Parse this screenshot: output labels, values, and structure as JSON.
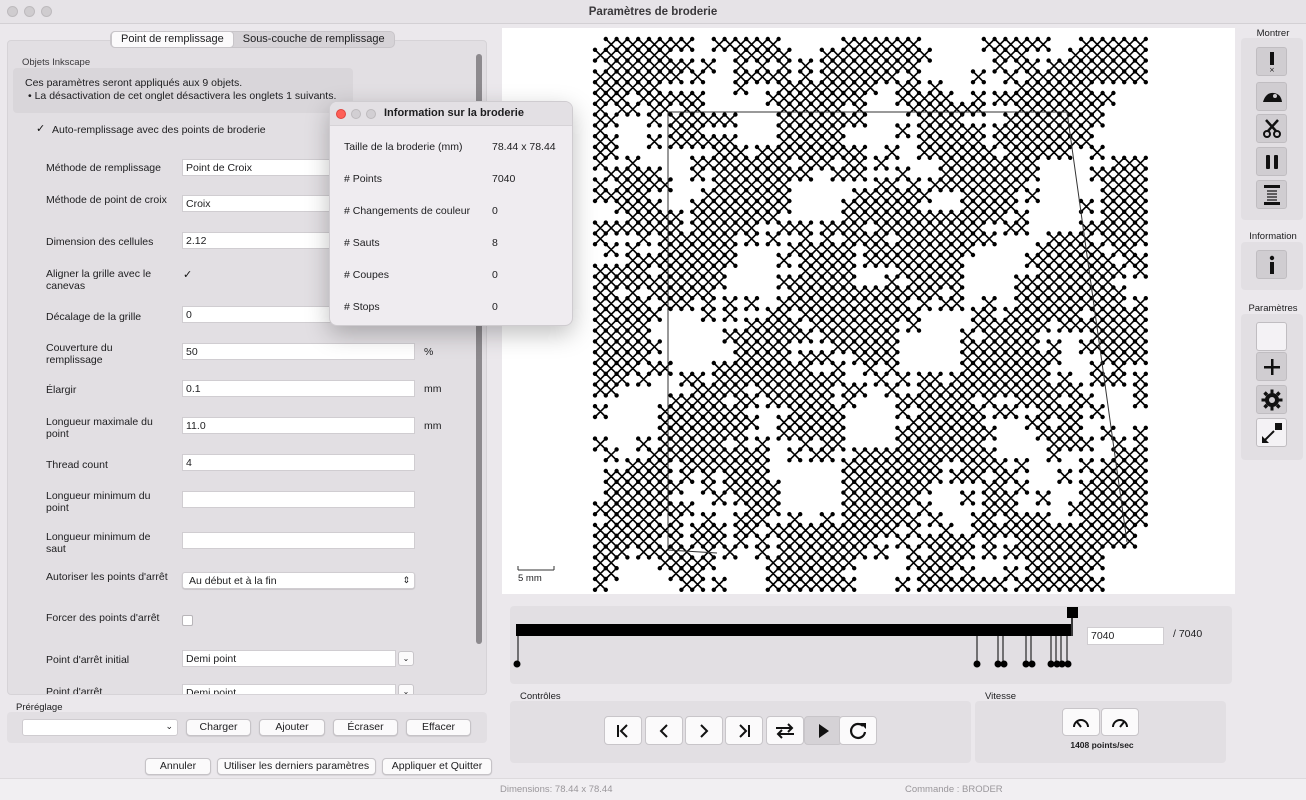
{
  "window": {
    "title": "Paramètres de broderie"
  },
  "tabs": [
    "Point de remplissage",
    "Sous-couche de remplissage"
  ],
  "section_label": "Objets Inkscape",
  "note": {
    "line1": "Ces paramètres seront appliqués aux 9 objets.",
    "line2": "• La désactivation de cet onglet désactivera les onglets 1 suivants."
  },
  "autofill_label": "Auto-remplissage avec des points de broderie",
  "fields": {
    "fill_method": {
      "label": "Méthode de remplissage",
      "value": "Point de Croix"
    },
    "stitch_method": {
      "label": "Méthode de point de croix",
      "value": "Croix"
    },
    "cell_size": {
      "label": "Dimension des cellules",
      "value": "2.12"
    },
    "align_grid": {
      "label": "Aligner la grille avec le canevas"
    },
    "grid_offset": {
      "label": "Décalage de la grille",
      "value": "0"
    },
    "coverage": {
      "label": "Couverture du remplissage",
      "value": "50",
      "unit": "%"
    },
    "expand": {
      "label": "Élargir",
      "value": "0.1",
      "unit": "mm"
    },
    "max_length": {
      "label": "Longueur maximale du point",
      "value": "11.0",
      "unit": "mm"
    },
    "thread_count": {
      "label": "Thread count",
      "value": "4"
    },
    "min_stitch": {
      "label": "Longueur minimum du point",
      "value": ""
    },
    "min_jump": {
      "label": "Longueur minimum de saut",
      "value": ""
    },
    "allow_lock": {
      "label": "Autoriser les points d'arrêt",
      "value": "Au début et à la fin"
    },
    "force_lock": {
      "label": "Forcer des points d'arrêt"
    },
    "initial_lock": {
      "label": "Point d'arrêt initial",
      "value": "Demi point"
    },
    "final_lock": {
      "label": "Point d'arrêt",
      "value": "Demi point"
    }
  },
  "preset": {
    "label": "Préréglage",
    "load": "Charger",
    "add": "Ajouter",
    "overwrite": "Écraser",
    "delete": "Effacer"
  },
  "footer": {
    "cancel": "Annuler",
    "use_last": "Utiliser les derniers paramètres",
    "apply_quit": "Appliquer et Quitter"
  },
  "preview": {
    "scale_label": "5 mm"
  },
  "timeline": {
    "current": "7040",
    "total": "/ 7040",
    "progress": 1.0
  },
  "controls": {
    "label": "Contrôles"
  },
  "speed": {
    "label": "Vitesse",
    "value": "1408 points/sec"
  },
  "sidebar": {
    "show_label": "Montrer",
    "info_label": "Information",
    "params_label": "Paramètres"
  },
  "status": {
    "dimensions": "Dimensions: 78.44 x 78.44",
    "command": "Commande : BRODER"
  },
  "dialog": {
    "title": "Information sur la broderie",
    "rows": [
      {
        "label": "Taille de la broderie (mm)",
        "value": "78.44 x 78.44"
      },
      {
        "label": "# Points",
        "value": "7040"
      },
      {
        "label": "# Changements de couleur",
        "value": "0"
      },
      {
        "label": "# Sauts",
        "value": "8"
      },
      {
        "label": "# Coupes",
        "value": "0"
      },
      {
        "label": "# Stops",
        "value": "0"
      }
    ]
  }
}
